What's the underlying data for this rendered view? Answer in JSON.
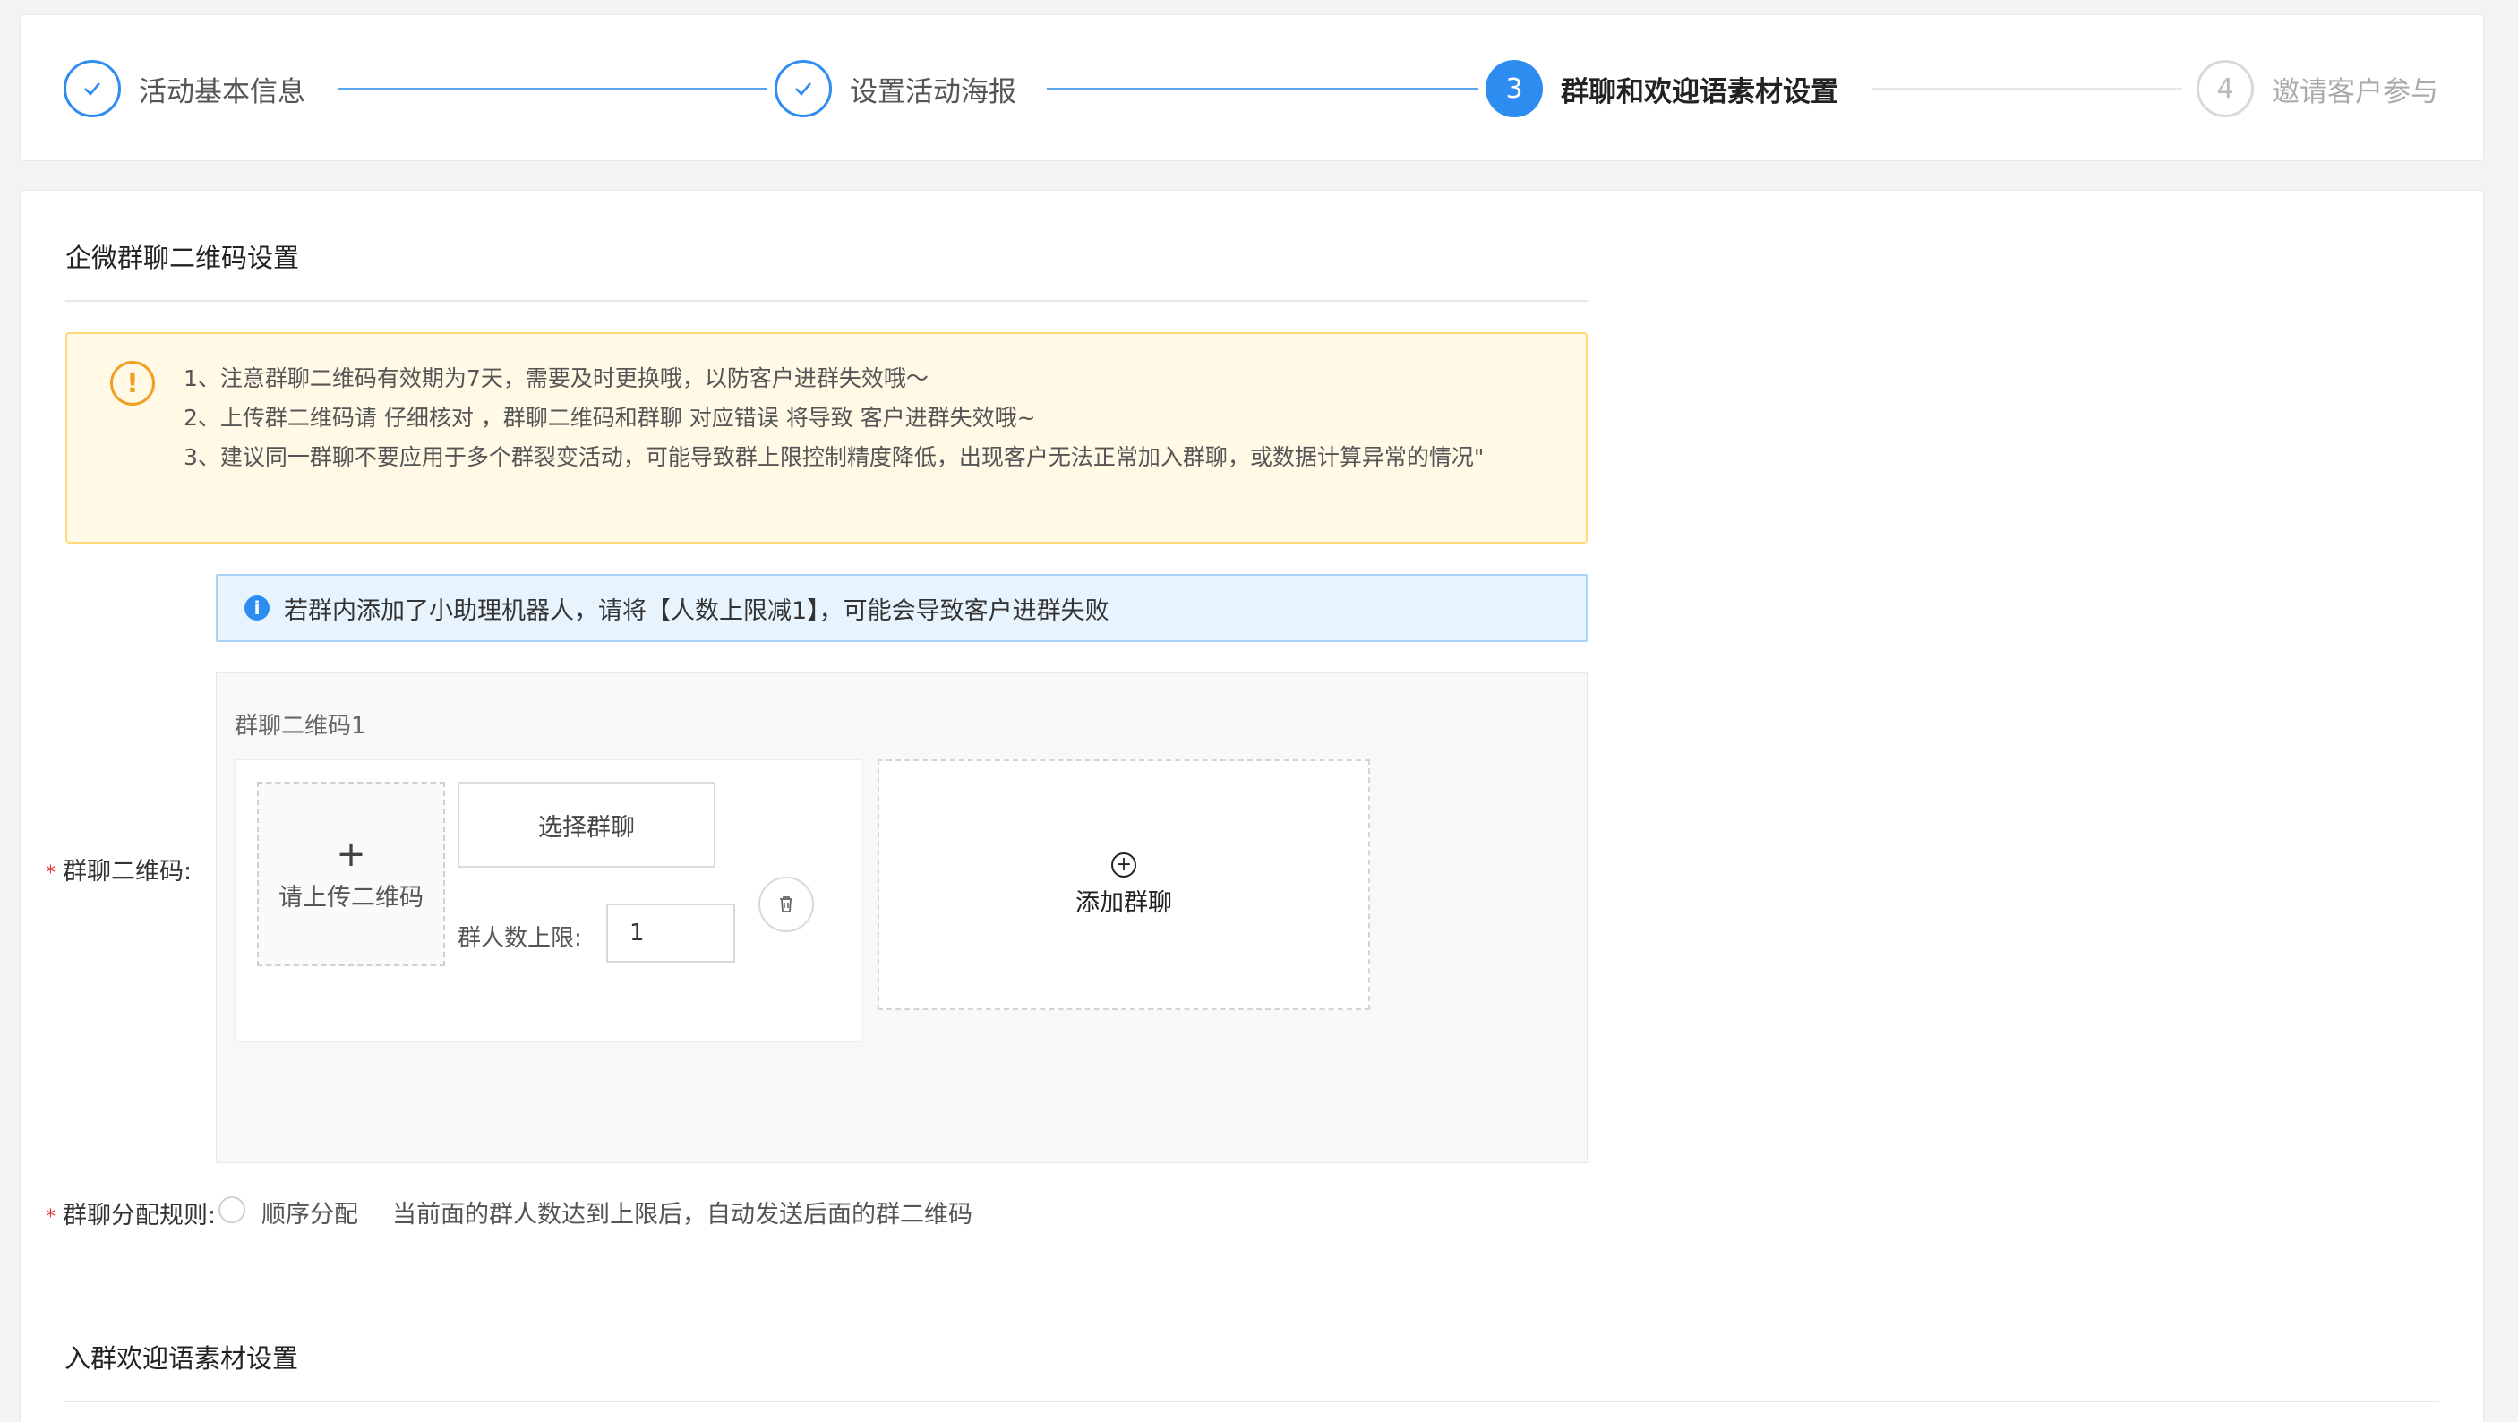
{
  "steps": [
    {
      "number": "1",
      "title": "活动基本信息",
      "state": "done"
    },
    {
      "number": "2",
      "title": "设置活动海报",
      "state": "done"
    },
    {
      "number": "3",
      "title": "群聊和欢迎语素材设置",
      "state": "active"
    },
    {
      "number": "4",
      "title": "邀请客户参与",
      "state": "todo"
    }
  ],
  "qr_section": {
    "title": "企微群聊二维码设置",
    "warnings": [
      "1、注意群聊二维码有效期为7天，需要及时更换哦，以防客户进群失效哦～",
      "2、上传群二维码请 仔细核对 ，群聊二维码和群聊 对应错误 将导致 客户进群失效哦~",
      "3、建议同一群聊不要应用于多个群裂变活动，可能导致群上限控制精度降低，出现客户无法正常加入群聊，或数据计算异常的情况\""
    ],
    "warning_icon": "!",
    "info_text": "若群内添加了小助理机器人，请将【人数上限减1】，可能会导致客户进群失败",
    "info_icon": "i",
    "field_label": "群聊二维码:",
    "qr_item_title": "群聊二维码1",
    "upload_plus": "+",
    "upload_text": "请上传二维码",
    "select_group_label": "选择群聊",
    "limit_label": "群人数上限:",
    "limit_value": "1",
    "add_group_icon": "+",
    "add_group_label": "添加群聊",
    "rule_label": "群聊分配规则:",
    "rule_option": "顺序分配",
    "rule_desc": "当前面的群人数达到上限后，自动发送后面的群二维码"
  },
  "welcome_section": {
    "title": "入群欢迎语素材设置"
  },
  "colors": {
    "primary": "#2d8cf0",
    "warning_bg": "#fff9e6",
    "warning_border": "#ffd97a",
    "info_bg": "#e8f4fd",
    "required": "#e4393c"
  }
}
